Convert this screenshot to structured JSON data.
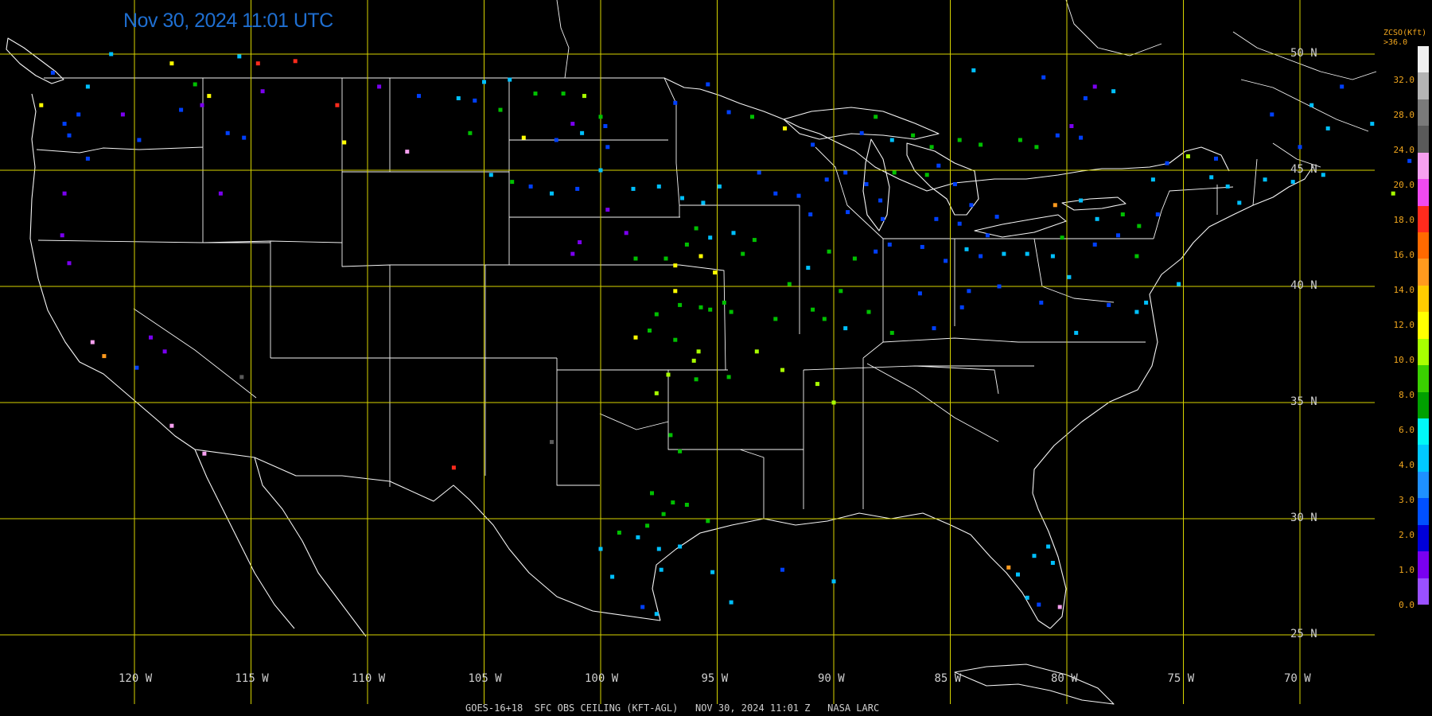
{
  "timestamp": "Nov 30, 2024 11:01 UTC",
  "footer_text": "GOES-16+18  SFC OBS CEILING (KFT-AGL)   NOV 30, 2024 11:01 Z   NASA LARC",
  "legend": {
    "title_line1": "ZCSO(Kft)",
    "title_line2": ">36.0",
    "labels": [
      "32.0",
      "28.0",
      "24.0",
      "20.0",
      "18.0",
      "16.0",
      "14.0",
      "12.0",
      "10.0",
      "8.0",
      "6.0",
      "4.0",
      "3.0",
      "2.0",
      "1.0",
      "0.0"
    ],
    "colors": [
      "#f0f0f0",
      "#b4b4b4",
      "#7a7a7a",
      "#5a5a5a",
      "#f7a0f0",
      "#f04af0",
      "#ff2b1d",
      "#ff6a00",
      "#ff9a1e",
      "#ffcc00",
      "#ffff00",
      "#a8ff00",
      "#3ad000",
      "#00a000",
      "#00f8f8",
      "#00c8ff",
      "#1e90ff",
      "#0050ff",
      "#0000d8",
      "#7a00f0",
      "#9a50ff"
    ]
  },
  "grid": {
    "latitudes": [
      "50 N",
      "45 N",
      "40 N",
      "35 N",
      "30 N",
      "25 N"
    ],
    "longitudes": [
      "120 W",
      "115 W",
      "110 W",
      "105 W",
      "100 W",
      "95 W",
      "90 W",
      "85 W",
      "80 W",
      "75 W",
      "70 W"
    ]
  },
  "map_colors": {
    "background": "#000000",
    "borders": "#f5f5f5",
    "grid": "#d7d400"
  },
  "observations": [
    {
      "lon": -123.5,
      "lat": 49.2,
      "color": "#0040ff"
    },
    {
      "lon": -124.0,
      "lat": 47.8,
      "color": "#ffff00"
    },
    {
      "lon": -123.0,
      "lat": 47.0,
      "color": "#0040ff"
    },
    {
      "lon": -122.4,
      "lat": 47.4,
      "color": "#0040ff"
    },
    {
      "lon": -122.8,
      "lat": 46.5,
      "color": "#0040ff"
    },
    {
      "lon": -122.0,
      "lat": 48.6,
      "color": "#00c0ff"
    },
    {
      "lon": -121.0,
      "lat": 50.0,
      "color": "#00c0ff"
    },
    {
      "lon": -120.5,
      "lat": 47.4,
      "color": "#7a00f0"
    },
    {
      "lon": -119.8,
      "lat": 46.3,
      "color": "#0040ff"
    },
    {
      "lon": -118.4,
      "lat": 49.6,
      "color": "#ffff00"
    },
    {
      "lon": -118.0,
      "lat": 47.6,
      "color": "#0040ff"
    },
    {
      "lon": -117.4,
      "lat": 48.7,
      "color": "#00c000"
    },
    {
      "lon": -116.8,
      "lat": 48.2,
      "color": "#ffff00"
    },
    {
      "lon": -117.1,
      "lat": 47.8,
      "color": "#7a00f0"
    },
    {
      "lon": -116.0,
      "lat": 46.6,
      "color": "#0040ff"
    },
    {
      "lon": -115.5,
      "lat": 49.9,
      "color": "#00c0ff"
    },
    {
      "lon": -114.7,
      "lat": 49.6,
      "color": "#ff2b1d"
    },
    {
      "lon": -113.1,
      "lat": 49.7,
      "color": "#ff2b1d"
    },
    {
      "lon": -114.5,
      "lat": 48.4,
      "color": "#7a00f0"
    },
    {
      "lon": -115.3,
      "lat": 46.4,
      "color": "#0040ff"
    },
    {
      "lon": -116.3,
      "lat": 44.0,
      "color": "#7a00f0"
    },
    {
      "lon": -122.0,
      "lat": 45.5,
      "color": "#0040ff"
    },
    {
      "lon": -123.0,
      "lat": 44.0,
      "color": "#7a00f0"
    },
    {
      "lon": -123.1,
      "lat": 42.2,
      "color": "#7a00f0"
    },
    {
      "lon": -122.8,
      "lat": 41.0,
      "color": "#7a00f0"
    },
    {
      "lon": -121.8,
      "lat": 37.6,
      "color": "#f7a0f0"
    },
    {
      "lon": -121.3,
      "lat": 37.0,
      "color": "#ff9a1e"
    },
    {
      "lon": -119.3,
      "lat": 37.8,
      "color": "#7a00f0"
    },
    {
      "lon": -118.7,
      "lat": 37.2,
      "color": "#7a00f0"
    },
    {
      "lon": -119.9,
      "lat": 36.5,
      "color": "#0040ff"
    },
    {
      "lon": -118.4,
      "lat": 34.0,
      "color": "#f7a0f0"
    },
    {
      "lon": -117.0,
      "lat": 32.8,
      "color": "#f7a0f0"
    },
    {
      "lon": -115.4,
      "lat": 36.1,
      "color": "#5a5a5a"
    },
    {
      "lon": -111.3,
      "lat": 47.8,
      "color": "#ff2b1d"
    },
    {
      "lon": -111.0,
      "lat": 46.2,
      "color": "#ffff00"
    },
    {
      "lon": -108.3,
      "lat": 45.8,
      "color": "#f7a0f0"
    },
    {
      "lon": -109.5,
      "lat": 48.6,
      "color": "#7a00f0"
    },
    {
      "lon": -107.8,
      "lat": 48.2,
      "color": "#0040ff"
    },
    {
      "lon": -106.1,
      "lat": 48.1,
      "color": "#00c0ff"
    },
    {
      "lon": -105.4,
      "lat": 48.0,
      "color": "#0040ff"
    },
    {
      "lon": -105.0,
      "lat": 48.8,
      "color": "#00c0ff"
    },
    {
      "lon": -103.9,
      "lat": 48.9,
      "color": "#00c0ff"
    },
    {
      "lon": -104.3,
      "lat": 47.6,
      "color": "#00c000"
    },
    {
      "lon": -105.6,
      "lat": 46.6,
      "color": "#00c000"
    },
    {
      "lon": -103.3,
      "lat": 46.4,
      "color": "#ffff00"
    },
    {
      "lon": -103.8,
      "lat": 44.5,
      "color": "#00c000"
    },
    {
      "lon": -104.7,
      "lat": 44.8,
      "color": "#00c0ff"
    },
    {
      "lon": -103.0,
      "lat": 44.3,
      "color": "#0040ff"
    },
    {
      "lon": -102.8,
      "lat": 48.3,
      "color": "#00c000"
    },
    {
      "lon": -101.6,
      "lat": 48.3,
      "color": "#00c000"
    },
    {
      "lon": -100.7,
      "lat": 48.2,
      "color": "#a8ff00"
    },
    {
      "lon": -100.0,
      "lat": 47.3,
      "color": "#00c000"
    },
    {
      "lon": -101.2,
      "lat": 47.0,
      "color": "#7a00f0"
    },
    {
      "lon": -99.8,
      "lat": 46.9,
      "color": "#0040ff"
    },
    {
      "lon": -101.9,
      "lat": 46.3,
      "color": "#0040ff"
    },
    {
      "lon": -100.8,
      "lat": 46.6,
      "color": "#00c0ff"
    },
    {
      "lon": -99.7,
      "lat": 46.0,
      "color": "#0040ff"
    },
    {
      "lon": -100.0,
      "lat": 45.0,
      "color": "#00c0ff"
    },
    {
      "lon": -101.0,
      "lat": 44.2,
      "color": "#0040ff"
    },
    {
      "lon": -102.1,
      "lat": 44.0,
      "color": "#00c0ff"
    },
    {
      "lon": -98.6,
      "lat": 44.2,
      "color": "#00c0ff"
    },
    {
      "lon": -97.5,
      "lat": 44.3,
      "color": "#00c0ff"
    },
    {
      "lon": -96.5,
      "lat": 43.8,
      "color": "#00c0ff"
    },
    {
      "lon": -99.7,
      "lat": 43.3,
      "color": "#7a00f0"
    },
    {
      "lon": -98.9,
      "lat": 42.3,
      "color": "#7a00f0"
    },
    {
      "lon": -100.9,
      "lat": 41.9,
      "color": "#7a00f0"
    },
    {
      "lon": -101.2,
      "lat": 41.4,
      "color": "#7a00f0"
    },
    {
      "lon": -98.5,
      "lat": 41.2,
      "color": "#00c000"
    },
    {
      "lon": -97.2,
      "lat": 41.2,
      "color": "#00c000"
    },
    {
      "lon": -96.8,
      "lat": 40.9,
      "color": "#ffff00"
    },
    {
      "lon": -96.3,
      "lat": 41.8,
      "color": "#00c000"
    },
    {
      "lon": -95.9,
      "lat": 42.5,
      "color": "#00c000"
    },
    {
      "lon": -95.7,
      "lat": 41.3,
      "color": "#ffff00"
    },
    {
      "lon": -95.1,
      "lat": 40.6,
      "color": "#ffff00"
    },
    {
      "lon": -95.3,
      "lat": 42.1,
      "color": "#00c0ff"
    },
    {
      "lon": -94.3,
      "lat": 42.3,
      "color": "#00c0ff"
    },
    {
      "lon": -93.4,
      "lat": 42.0,
      "color": "#00c000"
    },
    {
      "lon": -93.9,
      "lat": 41.4,
      "color": "#00c000"
    },
    {
      "lon": -95.6,
      "lat": 43.6,
      "color": "#00c0ff"
    },
    {
      "lon": -94.9,
      "lat": 44.3,
      "color": "#00c0ff"
    },
    {
      "lon": -93.2,
      "lat": 44.9,
      "color": "#0040ff"
    },
    {
      "lon": -92.5,
      "lat": 44.0,
      "color": "#0040ff"
    },
    {
      "lon": -91.5,
      "lat": 43.9,
      "color": "#0040ff"
    },
    {
      "lon": -91.0,
      "lat": 43.1,
      "color": "#0040ff"
    },
    {
      "lon": -90.3,
      "lat": 44.6,
      "color": "#0040ff"
    },
    {
      "lon": -89.5,
      "lat": 44.9,
      "color": "#0040ff"
    },
    {
      "lon": -88.6,
      "lat": 44.4,
      "color": "#0040ff"
    },
    {
      "lon": -89.4,
      "lat": 43.2,
      "color": "#0040ff"
    },
    {
      "lon": -88.0,
      "lat": 43.7,
      "color": "#0040ff"
    },
    {
      "lon": -87.9,
      "lat": 42.9,
      "color": "#0040ff"
    },
    {
      "lon": -90.9,
      "lat": 46.1,
      "color": "#0040ff"
    },
    {
      "lon": -88.8,
      "lat": 46.6,
      "color": "#0040ff"
    },
    {
      "lon": -87.5,
      "lat": 46.3,
      "color": "#00c0ff"
    },
    {
      "lon": -92.1,
      "lat": 46.8,
      "color": "#ffff00"
    },
    {
      "lon": -93.5,
      "lat": 47.3,
      "color": "#00c000"
    },
    {
      "lon": -94.5,
      "lat": 47.5,
      "color": "#0040ff"
    },
    {
      "lon": -95.4,
      "lat": 48.7,
      "color": "#0040ff"
    },
    {
      "lon": -96.8,
      "lat": 47.9,
      "color": "#0040ff"
    },
    {
      "lon": -85.5,
      "lat": 45.2,
      "color": "#0040ff"
    },
    {
      "lon": -84.8,
      "lat": 44.4,
      "color": "#0040ff"
    },
    {
      "lon": -84.1,
      "lat": 43.5,
      "color": "#0040ff"
    },
    {
      "lon": -85.6,
      "lat": 42.9,
      "color": "#0040ff"
    },
    {
      "lon": -84.6,
      "lat": 42.7,
      "color": "#0040ff"
    },
    {
      "lon": -83.4,
      "lat": 42.2,
      "color": "#0040ff"
    },
    {
      "lon": -83.0,
      "lat": 43.0,
      "color": "#0040ff"
    },
    {
      "lon": -86.2,
      "lat": 41.7,
      "color": "#0040ff"
    },
    {
      "lon": -85.2,
      "lat": 41.1,
      "color": "#0040ff"
    },
    {
      "lon": -84.3,
      "lat": 41.6,
      "color": "#00c0ff"
    },
    {
      "lon": -83.7,
      "lat": 41.3,
      "color": "#0040ff"
    },
    {
      "lon": -82.7,
      "lat": 41.4,
      "color": "#00c0ff"
    },
    {
      "lon": -81.7,
      "lat": 41.4,
      "color": "#00c0ff"
    },
    {
      "lon": -80.6,
      "lat": 41.3,
      "color": "#00c0ff"
    },
    {
      "lon": -79.9,
      "lat": 40.4,
      "color": "#00c0ff"
    },
    {
      "lon": -78.8,
      "lat": 41.8,
      "color": "#0040ff"
    },
    {
      "lon": -77.8,
      "lat": 42.2,
      "color": "#0040ff"
    },
    {
      "lon": -76.9,
      "lat": 42.6,
      "color": "#00c000"
    },
    {
      "lon": -76.1,
      "lat": 43.1,
      "color": "#0040ff"
    },
    {
      "lon": -78.7,
      "lat": 42.9,
      "color": "#00c0ff"
    },
    {
      "lon": -77.6,
      "lat": 43.1,
      "color": "#00c000"
    },
    {
      "lon": -79.4,
      "lat": 43.7,
      "color": "#00c0ff"
    },
    {
      "lon": -80.5,
      "lat": 43.5,
      "color": "#ff9a1e"
    },
    {
      "lon": -76.3,
      "lat": 44.6,
      "color": "#00c0ff"
    },
    {
      "lon": -73.8,
      "lat": 44.7,
      "color": "#00c0ff"
    },
    {
      "lon": -73.1,
      "lat": 44.3,
      "color": "#00c0ff"
    },
    {
      "lon": -72.6,
      "lat": 43.6,
      "color": "#00c0ff"
    },
    {
      "lon": -71.5,
      "lat": 44.6,
      "color": "#00c0ff"
    },
    {
      "lon": -70.3,
      "lat": 44.5,
      "color": "#00c0ff"
    },
    {
      "lon": -69.0,
      "lat": 44.8,
      "color": "#00c0ff"
    },
    {
      "lon": -68.8,
      "lat": 46.8,
      "color": "#00c0ff"
    },
    {
      "lon": -70.0,
      "lat": 46.0,
      "color": "#0040ff"
    },
    {
      "lon": -73.6,
      "lat": 45.5,
      "color": "#0040ff"
    },
    {
      "lon": -75.7,
      "lat": 45.3,
      "color": "#0040ff"
    },
    {
      "lon": -80.4,
      "lat": 46.5,
      "color": "#0040ff"
    },
    {
      "lon": -79.4,
      "lat": 46.4,
      "color": "#0040ff"
    },
    {
      "lon": -79.2,
      "lat": 48.1,
      "color": "#0040ff"
    },
    {
      "lon": -78.0,
      "lat": 48.4,
      "color": "#00c0ff"
    },
    {
      "lon": -84.0,
      "lat": 49.3,
      "color": "#00c0ff"
    },
    {
      "lon": -81.0,
      "lat": 49.0,
      "color": "#0040ff"
    },
    {
      "lon": -79.8,
      "lat": 46.9,
      "color": "#7a00f0"
    },
    {
      "lon": -78.8,
      "lat": 48.6,
      "color": "#7a00f0"
    },
    {
      "lon": -75.2,
      "lat": 40.1,
      "color": "#00c0ff"
    },
    {
      "lon": -77.0,
      "lat": 38.9,
      "color": "#00c0ff"
    },
    {
      "lon": -76.6,
      "lat": 39.3,
      "color": "#00c0ff"
    },
    {
      "lon": -78.2,
      "lat": 39.2,
      "color": "#0040ff"
    },
    {
      "lon": -79.6,
      "lat": 38.0,
      "color": "#00c0ff"
    },
    {
      "lon": -81.1,
      "lat": 39.3,
      "color": "#0040ff"
    },
    {
      "lon": -82.9,
      "lat": 40.0,
      "color": "#0040ff"
    },
    {
      "lon": -84.2,
      "lat": 39.8,
      "color": "#0040ff"
    },
    {
      "lon": -84.5,
      "lat": 39.1,
      "color": "#0040ff"
    },
    {
      "lon": -85.7,
      "lat": 38.2,
      "color": "#0040ff"
    },
    {
      "lon": -86.3,
      "lat": 39.7,
      "color": "#0040ff"
    },
    {
      "lon": -87.6,
      "lat": 41.8,
      "color": "#0040ff"
    },
    {
      "lon": -88.2,
      "lat": 41.5,
      "color": "#0040ff"
    },
    {
      "lon": -89.1,
      "lat": 41.2,
      "color": "#00c000"
    },
    {
      "lon": -90.2,
      "lat": 41.5,
      "color": "#00c000"
    },
    {
      "lon": -91.1,
      "lat": 40.8,
      "color": "#00c0ff"
    },
    {
      "lon": -89.7,
      "lat": 39.8,
      "color": "#00c000"
    },
    {
      "lon": -90.4,
      "lat": 38.6,
      "color": "#00c000"
    },
    {
      "lon": -89.5,
      "lat": 38.2,
      "color": "#00c0ff"
    },
    {
      "lon": -88.5,
      "lat": 38.9,
      "color": "#00c000"
    },
    {
      "lon": -87.5,
      "lat": 38.0,
      "color": "#00c000"
    },
    {
      "lon": -90.9,
      "lat": 39.0,
      "color": "#00c000"
    },
    {
      "lon": -91.9,
      "lat": 40.1,
      "color": "#00c000"
    },
    {
      "lon": -92.5,
      "lat": 38.6,
      "color": "#00c000"
    },
    {
      "lon": -93.3,
      "lat": 37.2,
      "color": "#a8ff00"
    },
    {
      "lon": -94.4,
      "lat": 38.9,
      "color": "#00c000"
    },
    {
      "lon": -94.7,
      "lat": 39.3,
      "color": "#00c000"
    },
    {
      "lon": -95.3,
      "lat": 39.0,
      "color": "#00c000"
    },
    {
      "lon": -95.7,
      "lat": 39.1,
      "color": "#00c000"
    },
    {
      "lon": -96.6,
      "lat": 39.2,
      "color": "#00c000"
    },
    {
      "lon": -97.6,
      "lat": 38.8,
      "color": "#00c000"
    },
    {
      "lon": -97.9,
      "lat": 38.1,
      "color": "#00c000"
    },
    {
      "lon": -96.8,
      "lat": 37.7,
      "color": "#00c000"
    },
    {
      "lon": -95.8,
      "lat": 37.2,
      "color": "#a8ff00"
    },
    {
      "lon": -97.1,
      "lat": 36.2,
      "color": "#a8ff00"
    },
    {
      "lon": -96.0,
      "lat": 36.8,
      "color": "#a8ff00"
    },
    {
      "lon": -97.6,
      "lat": 35.4,
      "color": "#a8ff00"
    },
    {
      "lon": -95.9,
      "lat": 36.0,
      "color": "#00c000"
    },
    {
      "lon": -94.5,
      "lat": 36.1,
      "color": "#00c000"
    },
    {
      "lon": -92.2,
      "lat": 36.4,
      "color": "#a8ff00"
    },
    {
      "lon": -90.7,
      "lat": 35.8,
      "color": "#a8ff00"
    },
    {
      "lon": -90.0,
      "lat": 35.0,
      "color": "#a8ff00"
    },
    {
      "lon": -96.8,
      "lat": 39.8,
      "color": "#ffff00"
    },
    {
      "lon": -98.5,
      "lat": 37.8,
      "color": "#ffff00"
    },
    {
      "lon": -97.0,
      "lat": 33.6,
      "color": "#00c000"
    },
    {
      "lon": -96.6,
      "lat": 32.9,
      "color": "#00c000"
    },
    {
      "lon": -97.8,
      "lat": 31.1,
      "color": "#00c000"
    },
    {
      "lon": -96.9,
      "lat": 30.7,
      "color": "#00c000"
    },
    {
      "lon": -98.0,
      "lat": 29.7,
      "color": "#00c000"
    },
    {
      "lon": -97.3,
      "lat": 30.2,
      "color": "#00c000"
    },
    {
      "lon": -96.3,
      "lat": 30.6,
      "color": "#00c000"
    },
    {
      "lon": -95.4,
      "lat": 29.9,
      "color": "#00c000"
    },
    {
      "lon": -99.2,
      "lat": 29.4,
      "color": "#00c000"
    },
    {
      "lon": -98.4,
      "lat": 29.2,
      "color": "#00c0ff"
    },
    {
      "lon": -97.5,
      "lat": 28.7,
      "color": "#00c0ff"
    },
    {
      "lon": -96.6,
      "lat": 28.8,
      "color": "#00c0ff"
    },
    {
      "lon": -97.4,
      "lat": 27.8,
      "color": "#00c0ff"
    },
    {
      "lon": -98.2,
      "lat": 26.2,
      "color": "#0040ff"
    },
    {
      "lon": -97.6,
      "lat": 25.9,
      "color": "#00c0ff"
    },
    {
      "lon": -99.5,
      "lat": 27.5,
      "color": "#00c0ff"
    },
    {
      "lon": -100.0,
      "lat": 28.7,
      "color": "#00c0ff"
    },
    {
      "lon": -95.2,
      "lat": 27.7,
      "color": "#00c0ff"
    },
    {
      "lon": -94.4,
      "lat": 26.4,
      "color": "#00c0ff"
    },
    {
      "lon": -92.2,
      "lat": 27.8,
      "color": "#0040ff"
    },
    {
      "lon": -90.0,
      "lat": 27.3,
      "color": "#00c0ff"
    },
    {
      "lon": -102.1,
      "lat": 33.3,
      "color": "#5a5a5a"
    },
    {
      "lon": -106.3,
      "lat": 32.2,
      "color": "#ff2b1d"
    },
    {
      "lon": -82.5,
      "lat": 27.9,
      "color": "#ff9a1e"
    },
    {
      "lon": -82.1,
      "lat": 27.6,
      "color": "#00c0ff"
    },
    {
      "lon": -81.4,
      "lat": 28.4,
      "color": "#00c0ff"
    },
    {
      "lon": -80.8,
      "lat": 28.8,
      "color": "#00c0ff"
    },
    {
      "lon": -80.6,
      "lat": 28.1,
      "color": "#00c0ff"
    },
    {
      "lon": -81.7,
      "lat": 26.6,
      "color": "#00c0ff"
    },
    {
      "lon": -80.3,
      "lat": 26.2,
      "color": "#f7a0f0"
    },
    {
      "lon": -81.2,
      "lat": 26.3,
      "color": "#0040ff"
    },
    {
      "lon": -88.2,
      "lat": 47.3,
      "color": "#00c000"
    },
    {
      "lon": -86.6,
      "lat": 46.5,
      "color": "#00c000"
    },
    {
      "lon": -84.6,
      "lat": 46.3,
      "color": "#00c000"
    },
    {
      "lon": -83.7,
      "lat": 46.1,
      "color": "#00c000"
    },
    {
      "lon": -81.3,
      "lat": 46.0,
      "color": "#00c000"
    },
    {
      "lon": -82.0,
      "lat": 46.3,
      "color": "#00c000"
    },
    {
      "lon": -87.4,
      "lat": 44.9,
      "color": "#00c000"
    },
    {
      "lon": -86.0,
      "lat": 44.8,
      "color": "#00c000"
    },
    {
      "lon": -85.8,
      "lat": 46.0,
      "color": "#00c000"
    },
    {
      "lon": -80.2,
      "lat": 42.1,
      "color": "#00c000"
    },
    {
      "lon": -77.0,
      "lat": 41.3,
      "color": "#00c000"
    },
    {
      "lon": -74.8,
      "lat": 45.6,
      "color": "#a8ff00"
    },
    {
      "lon": -71.2,
      "lat": 47.4,
      "color": "#0040ff"
    },
    {
      "lon": -69.5,
      "lat": 47.8,
      "color": "#00c0ff"
    },
    {
      "lon": -68.2,
      "lat": 48.6,
      "color": "#0040ff"
    },
    {
      "lon": -66.9,
      "lat": 47.0,
      "color": "#00c0ff"
    },
    {
      "lon": -65.3,
      "lat": 45.4,
      "color": "#0040ff"
    },
    {
      "lon": -66.0,
      "lat": 44.0,
      "color": "#a8ff00"
    }
  ]
}
